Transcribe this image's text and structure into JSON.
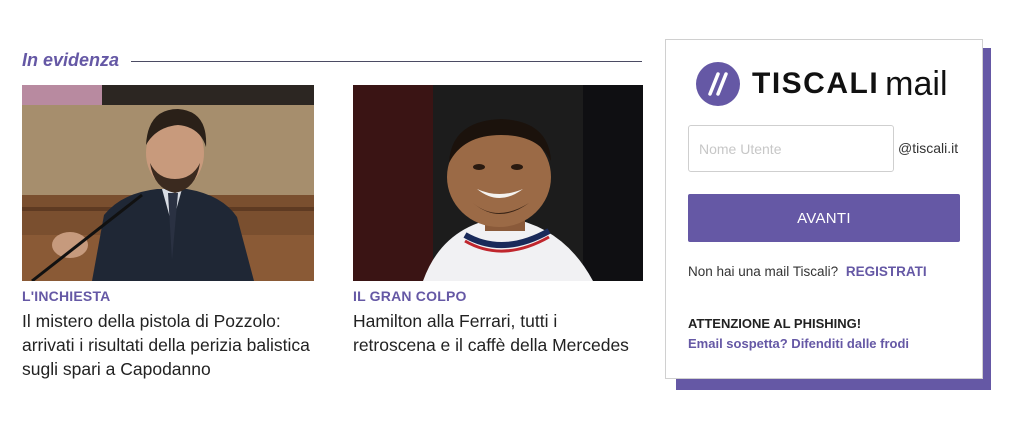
{
  "section": {
    "title": "In evidenza"
  },
  "articles": [
    {
      "kicker": "L'INCHIESTA",
      "headline": "Il mistero della pistola di Pozzolo: arrivati i risultati della perizia balistica sugli spari a Capodanno"
    },
    {
      "kicker": "IL GRAN COLPO",
      "headline": "Hamilton alla Ferrari, tutti i retroscena e il caffè della Mercedes"
    }
  ],
  "login": {
    "brand": "TISCALI",
    "product": "mail",
    "username_placeholder": "Nome Utente",
    "username_value": "",
    "domain_suffix": "@tiscali.it",
    "submit_label": "AVANTI",
    "signup_prompt": "Non hai una mail Tiscali?",
    "signup_link": "REGISTRATI",
    "phishing_title": "ATTENZIONE AL PHISHING!",
    "phishing_link": "Email sospetta? Difenditi dalle frodi"
  },
  "colors": {
    "accent": "#6558a5",
    "text": "#222222",
    "border": "#d0d0d0"
  }
}
